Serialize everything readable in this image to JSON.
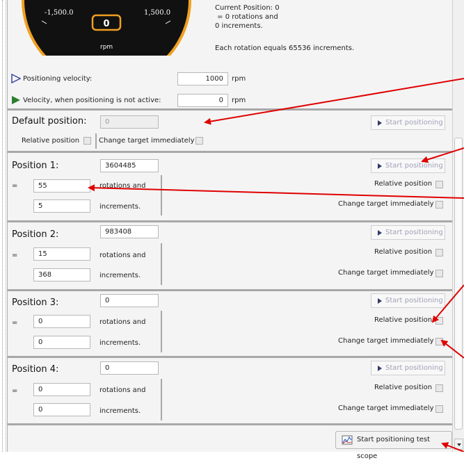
{
  "gauge": {
    "min": "-1,500.0",
    "max": "1,500.0",
    "value": "0",
    "unit": "rpm"
  },
  "info": {
    "current_position": "Current Position: 0",
    "rotations_line": " = 0 rotations and",
    "increments_line": "0 increments.",
    "rotation_note": "Each rotation equals 65536 increments."
  },
  "positioning_velocity": {
    "label": "Positioning velocity:",
    "value": "1000",
    "unit": "rpm"
  },
  "idle_velocity": {
    "label": "Velocity, when positioning is not active:",
    "value": "0",
    "unit": "rpm"
  },
  "default_position": {
    "label": "Default position:",
    "value": "0",
    "start_label": "Start positioning",
    "relative_label": "Relative position",
    "change_label": "Change target immediately"
  },
  "common": {
    "equals": "=",
    "rotations_and": "rotations and",
    "increments": "increments.",
    "start_label": "Start positioning",
    "relative_label": "Relative position",
    "change_label": "Change target immediately"
  },
  "positions": [
    {
      "label": "Position 1:",
      "value": "3604485",
      "rotations": "55",
      "increments": "5"
    },
    {
      "label": "Position 2:",
      "value": "983408",
      "rotations": "15",
      "increments": "368"
    },
    {
      "label": "Position 3:",
      "value": "0",
      "rotations": "0",
      "increments": "0"
    },
    {
      "label": "Position 4:",
      "value": "0",
      "rotations": "0",
      "increments": "0"
    }
  ],
  "scope_button": {
    "label": "Start positioning test scope"
  },
  "colors": {
    "annotation_arrow": "#e00000",
    "gauge_ring": "#f0a020",
    "velocity_marker": "#2e7d32",
    "positioning_marker": "#3a4aa0"
  }
}
